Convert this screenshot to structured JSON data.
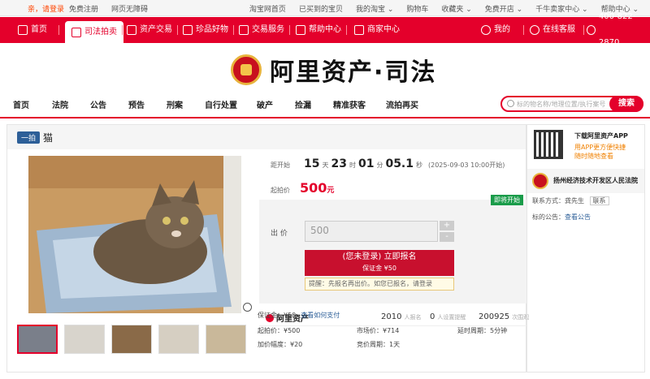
{
  "topbar": {
    "greeting": "亲，请登录",
    "register": "免费注册",
    "barrier_free": "网页无障碍",
    "right_links": [
      "淘宝网首页",
      "已买到的宝贝",
      "我的淘宝 ⌄",
      "购物车",
      "收藏夹 ⌄",
      "免费开店 ⌄",
      "千牛卖家中心 ⌄",
      "帮助中心 ⌄"
    ]
  },
  "nav": {
    "items": [
      "首页",
      "司法拍卖",
      "资产交易",
      "珍品好物",
      "交易服务",
      "帮助中心",
      "商家中心"
    ],
    "active_index": 1,
    "mine": "我的",
    "service": "在线客服",
    "phone": "400-822-2870"
  },
  "logo": {
    "text": "阿里资产·司法"
  },
  "categories": [
    "首页",
    "法院",
    "公告",
    "预告",
    "刑案",
    "自行处置",
    "破产",
    "捡漏",
    "精准获客",
    "流拍再买"
  ],
  "search": {
    "placeholder": "标的物名称/地理位置/执行案号",
    "button": "搜索"
  },
  "item": {
    "badge": "一拍",
    "title": "猫",
    "countdown_label": "距开始",
    "days": "15",
    "days_unit": "天",
    "hours": "23",
    "hours_unit": "时",
    "minutes": "01",
    "minutes_unit": "分",
    "seconds": "05.1",
    "seconds_unit": "秒",
    "start_date": "(2025-09-03 10:00开始)",
    "start_price_label": "起拍价",
    "start_price": "500",
    "start_price_unit": "元",
    "soon_tag": "即将开始",
    "bid_label": "出 价",
    "bid_value": "500",
    "plus": "+",
    "minus": "-",
    "signup_line1": "(您未登录) 立即报名",
    "signup_line2": "保证金 ¥50",
    "tip": "提醒：先报名再出价。如您已报名，请登录",
    "brand": "阿里资产",
    "enrolled_count": "2010",
    "enrolled_label": "人报名",
    "reminder_count": "0",
    "reminder_label": "人设置提醒",
    "views_count": "200925",
    "views_label": "次围观",
    "deposit": "保证金：¥50",
    "deposit_link": "查看如何支付",
    "start_price_row": "起拍价：¥500",
    "market_price": "市场价：¥714",
    "delay_period": "延时周期：5分钟",
    "increment": "加价幅度：¥20",
    "bid_period": "竞价周期：1天"
  },
  "side": {
    "download_title": "下载阿里资产APP",
    "download_sub1": "用APP更方便快捷",
    "download_sub2": "随时随地查看",
    "court_name": "扬州经济技术开发区人民法院",
    "contact": "联系方式：龚先生",
    "contact_link": "联系",
    "notice_label": "标的公告：",
    "notice_link": "查看公告"
  }
}
